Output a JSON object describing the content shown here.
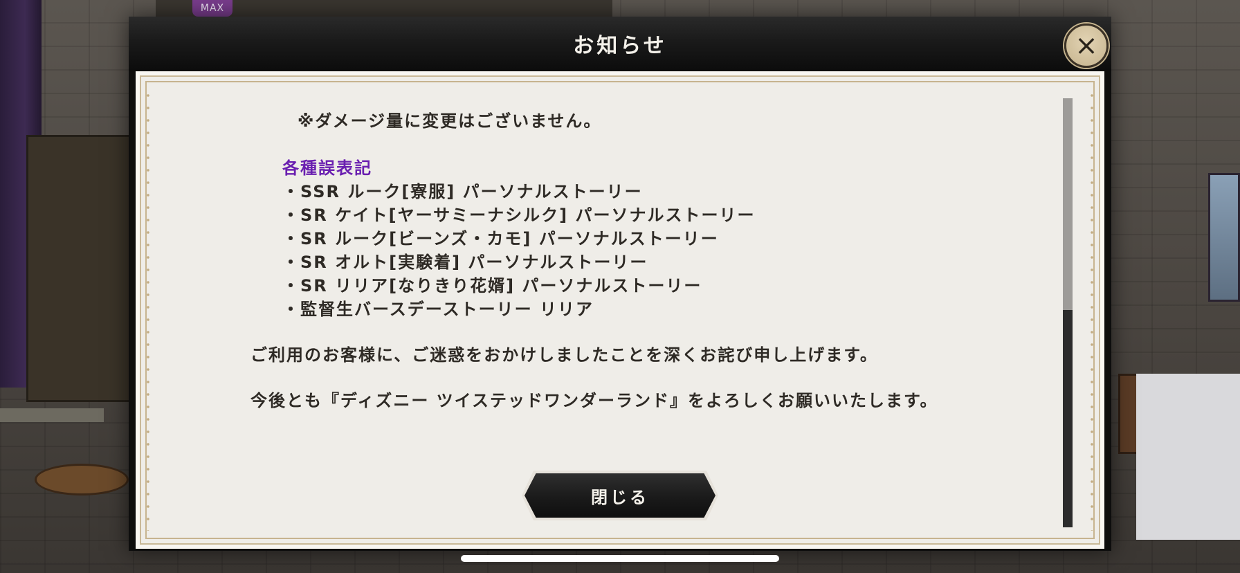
{
  "background": {
    "badge": "MAX"
  },
  "modal": {
    "title": "お知らせ",
    "close_icon": "×",
    "lines": [
      "※ダメージ量に変更はございません。",
      "各種誤表記",
      "・SSR ルーク[寮服] パーソナルストーリー",
      "・SR ケイト[ヤーサミーナシルク] パーソナルストーリー",
      "・SR ルーク[ビーンズ・カモ] パーソナルストーリー",
      "・SR オルト[実験着] パーソナルストーリー",
      "・SR リリア[なりきり花婿] パーソナルストーリー",
      "・監督生バースデーストーリー リリア",
      "ご利用のお客様に、ご迷惑をおかけしましたことを深くお詫び申し上げます。",
      "今後とも『ディズニー ツイステッドワンダーランド』をよろしくお願いいたします。"
    ],
    "close_button_label": "閉じる"
  },
  "colors": {
    "heading": "#6a1fb0",
    "text": "#2e2a25",
    "paper": "#efede8",
    "frame": "#c7b48f"
  }
}
